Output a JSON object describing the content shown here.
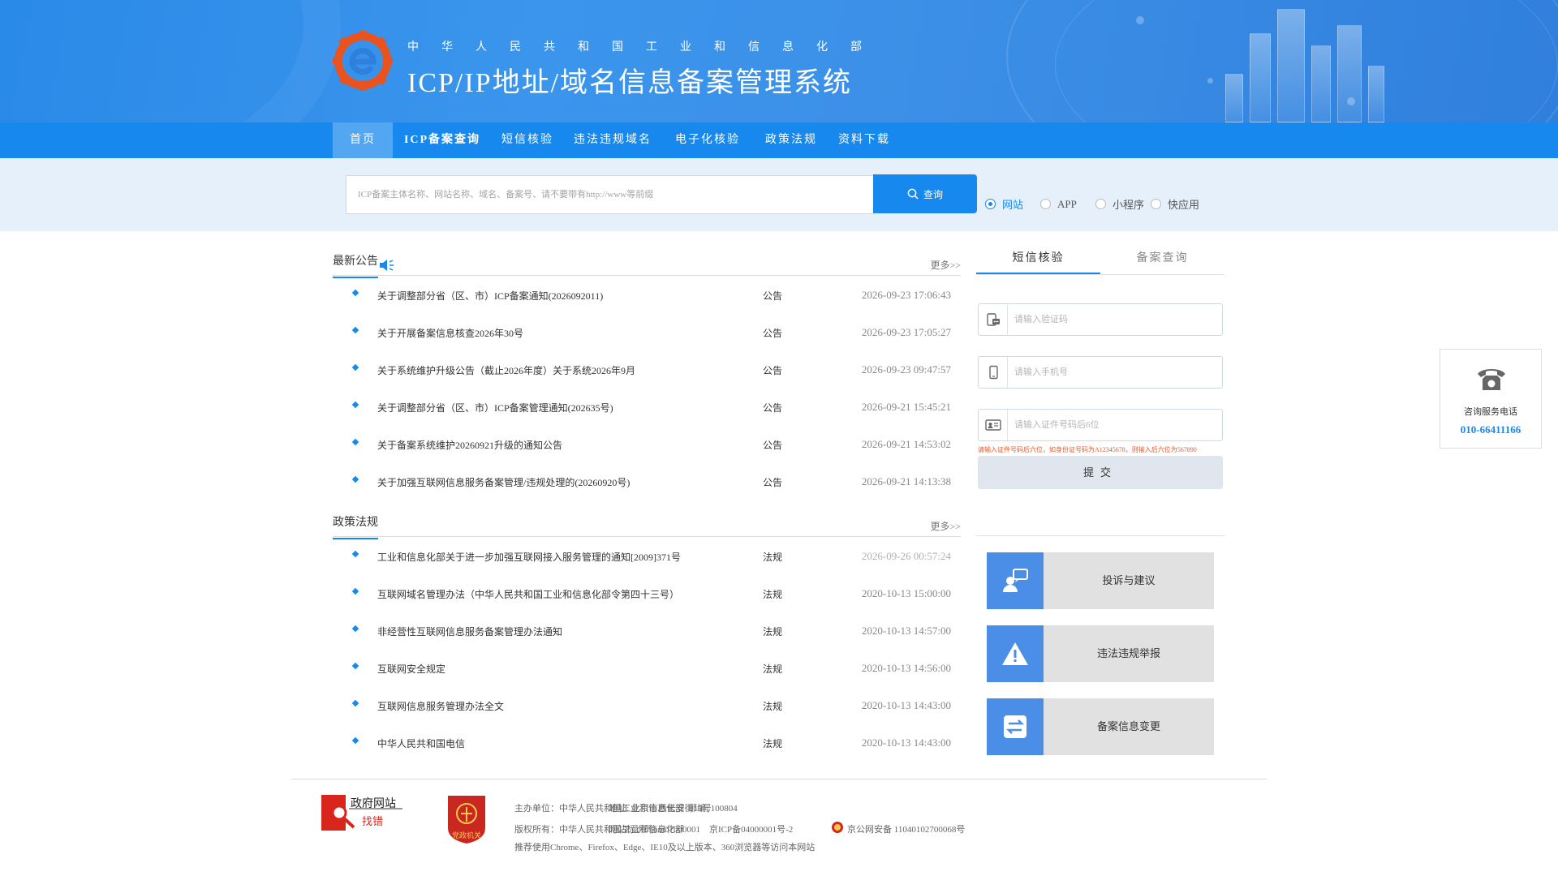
{
  "header": {
    "subtitle": "中华人民共和国工业和信息化部",
    "title": "ICP/IP地址/域名信息备案管理系统"
  },
  "nav": {
    "items": [
      {
        "label": "首页",
        "active": true
      },
      {
        "label": "ICP备案查询",
        "active": false
      },
      {
        "label": "短信核验",
        "active": false
      },
      {
        "label": "违法违规域名",
        "active": false
      },
      {
        "label": "电子化核验",
        "active": false
      },
      {
        "label": "政策法规",
        "active": false
      },
      {
        "label": "资料下载",
        "active": false
      }
    ]
  },
  "search": {
    "placeholder": "ICP备案主体名称、网站名称、域名、备案号、请不要带有http://www等前缀",
    "button_label": "查询",
    "options": [
      {
        "label": "网站",
        "checked": true
      },
      {
        "label": "APP",
        "checked": false
      },
      {
        "label": "小程序",
        "checked": false
      },
      {
        "label": "快应用",
        "checked": false
      }
    ]
  },
  "notices": {
    "title": "最新公告",
    "more": "更多>>",
    "items": [
      {
        "title": "关于调整部分省（区、市）ICP备案通知(2026092011)",
        "category": "公告",
        "date": "2026-09-23 17:06:43"
      },
      {
        "title": "关于开展备案信息核查2026年30号",
        "category": "公告",
        "date": "2026-09-23 17:05:27"
      },
      {
        "title": "关于系统维护升级公告（截止2026年度）关于系统2026年9月",
        "category": "公告",
        "date": "2026-09-23 09:47:57"
      },
      {
        "title": "关于调整部分省（区、市）ICP备案管理通知(202635号)",
        "category": "公告",
        "date": "2026-09-21 15:45:21"
      },
      {
        "title": "关于备案系统维护20260921升级的通知公告",
        "category": "公告",
        "date": "2026-09-21 14:53:02"
      },
      {
        "title": "关于加强互联网信息服务备案管理/违规处理的(20260920号)",
        "category": "公告",
        "date": "2026-09-21 14:13:38"
      }
    ]
  },
  "policies": {
    "title": "政策法规",
    "more": "更多>>",
    "items": [
      {
        "title": "工业和信息化部关于进一步加强互联网接入服务管理的通知[2009]371号",
        "category": "法规",
        "date": "2026-09-26 00:57:24"
      },
      {
        "title": "互联网域名管理办法（中华人民共和国工业和信息化部令第四十三号）",
        "category": "法规",
        "date": "2020-10-13 15:00:00"
      },
      {
        "title": "非经营性互联网信息服务备案管理办法通知",
        "category": "法规",
        "date": "2020-10-13 14:57:00"
      },
      {
        "title": "互联网安全规定",
        "category": "法规",
        "date": "2020-10-13 14:56:00"
      },
      {
        "title": "互联网信息服务管理办法全文",
        "category": "法规",
        "date": "2020-10-13 14:43:00"
      },
      {
        "title": "中华人民共和国电信",
        "category": "法规",
        "date": "2020-10-13 14:43:00"
      }
    ]
  },
  "login": {
    "tabs": [
      {
        "label": "短信核验",
        "active": true
      },
      {
        "label": "备案查询",
        "active": false
      }
    ],
    "fields": [
      {
        "placeholder": "请输入验证码",
        "icon": "sms-code-icon"
      },
      {
        "placeholder": "请输入手机号",
        "icon": "mobile-phone-icon"
      },
      {
        "placeholder": "请输入证件号码后6位",
        "icon": "id-card-icon"
      }
    ],
    "hint": "请输入证件号码后六位，如身份证号码为A12345678，则输入后六位为567890",
    "submit_label": "提交"
  },
  "shortcuts": [
    {
      "label": "投诉与建议",
      "icon": "feedback-icon"
    },
    {
      "label": "违法违规举报",
      "icon": "warning-icon"
    },
    {
      "label": "备案信息变更",
      "icon": "transfer-icon"
    }
  ],
  "phone": {
    "label": "咨询服务电话",
    "number": "010-66411166"
  },
  "footer": {
    "line1": {
      "sponsor": "主办单位：中华人民共和国工业和信息化部",
      "address": "地址: 北京市西长安街13号",
      "postcode": "邮编: 100804"
    },
    "line2": {
      "copyright": "版权所有：中华人民共和国工业和信息化部",
      "site_id": "网站标识码bm07000001",
      "icp": "京ICP备04000001号-2",
      "police": "京公网安备 11040102700068号"
    },
    "line3": "推荐使用Chrome、Firefox、Edge、IE10及以上版本、360浏览器等访问本网站",
    "gov_logo_text_1": "政府网站",
    "gov_logo_text_2": "找错",
    "party_logo_text": "党政机关"
  },
  "colors": {
    "primary": "#1688ee",
    "banner": "#3b95ec",
    "search_band": "#e6f0fa",
    "card_icon": "#4a8ee8"
  }
}
